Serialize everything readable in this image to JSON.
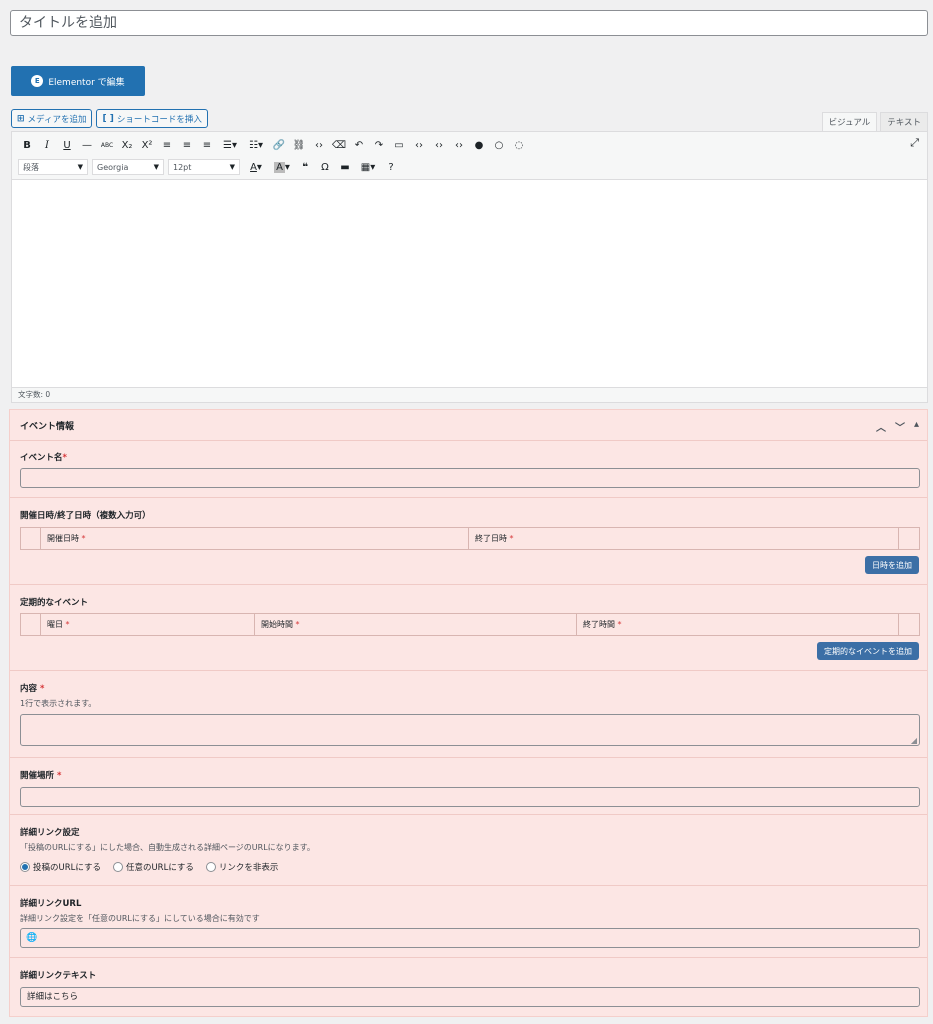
{
  "title_placeholder": "タイトルを追加",
  "elementor_button": "Elementor で編集",
  "media_buttons": {
    "add_media": "メディアを追加",
    "insert_shortcode": "ショートコードを挿入"
  },
  "editor_tabs": {
    "visual": "ビジュアル",
    "text": "テキスト"
  },
  "toolbar": {
    "format_select": "段落",
    "font_select": "Georgia",
    "size_select": "12pt"
  },
  "word_count": "文字数: 0",
  "metabox": {
    "title": "イベント情報",
    "event_name": {
      "label": "イベント名",
      "required": "*"
    },
    "dates": {
      "label": "開催日時/終了日時（複数入力可）",
      "col_start": "開催日時",
      "col_end": "終了日時",
      "required": "*",
      "add_button": "日時を追加"
    },
    "recurring": {
      "label": "定期的なイベント",
      "col_day": "曜日",
      "col_start": "開始時間",
      "col_end": "終了時間",
      "required": "*",
      "add_button": "定期的なイベントを追加"
    },
    "content": {
      "label": "内容",
      "required": "*",
      "desc": "1行で表示されます。"
    },
    "venue": {
      "label": "開催場所",
      "required": "*"
    },
    "link_setting": {
      "label": "詳細リンク設定",
      "desc": "「投稿のURLにする」にした場合、自動生成される詳細ページのURLになります。",
      "options": [
        "投稿のURLにする",
        "任意のURLにする",
        "リンクを非表示"
      ],
      "selected_index": 0
    },
    "link_url": {
      "label": "詳細リンクURL",
      "desc": "詳細リンク設定を「任意のURLにする」にしている場合に有効です"
    },
    "link_text": {
      "label": "詳細リンクテキスト",
      "value": "詳細はこちら"
    }
  }
}
